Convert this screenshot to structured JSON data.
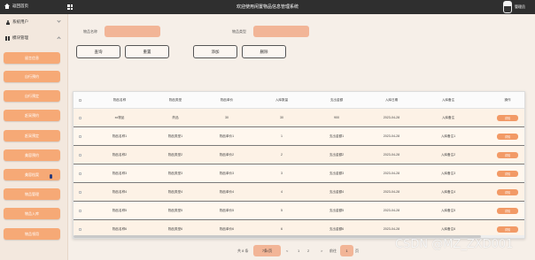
{
  "topbar": {
    "home_label": "返回首页",
    "title": "欢迎使用闲置物品信息管理系统",
    "username": "管理员"
  },
  "sidebar": {
    "groups": [
      {
        "label": "系统用户",
        "icon": "person-icon",
        "expanded": false
      },
      {
        "label": "模块管理",
        "icon": "apps-icon",
        "expanded": true
      }
    ],
    "items": [
      {
        "label": "留言信息"
      },
      {
        "label": "自行预约"
      },
      {
        "label": "自行预定"
      },
      {
        "label": "赶采预约"
      },
      {
        "label": "赶采预定"
      },
      {
        "label": "美容预约"
      },
      {
        "label": "美容档案"
      },
      {
        "label": "物品管理"
      },
      {
        "label": "物品入库"
      },
      {
        "label": "物品领用"
      }
    ],
    "active_item": "美容档案"
  },
  "search": {
    "name_label": "物品名称",
    "type_label": "物品类型",
    "name_value": "",
    "type_value": ""
  },
  "buttons": {
    "query": "查询",
    "reset": "重置",
    "add": "添加",
    "delete": "删除"
  },
  "table": {
    "columns": [
      "",
      "物品名称",
      "物品类型",
      "物品单价",
      "入库数量",
      "支出金额",
      "入库日期",
      "入库备注",
      "",
      "操作"
    ],
    "rows": [
      {
        "name": "xx物品",
        "type": "药品",
        "price": "30",
        "qty": "30",
        "amount": "900",
        "date": "2023-04-28",
        "note": "入库备注",
        "action": "详情"
      },
      {
        "name": "物品名称1",
        "type": "物品类型1",
        "price": "物品单价1",
        "qty": "1",
        "amount": "支出金额1",
        "date": "2023-04-28",
        "note": "入库备注1",
        "action": "详情"
      },
      {
        "name": "物品名称2",
        "type": "物品类型2",
        "price": "物品单价2",
        "qty": "2",
        "amount": "支出金额2",
        "date": "2023-04-28",
        "note": "入库备注2",
        "action": "详情"
      },
      {
        "name": "物品名称3",
        "type": "物品类型3",
        "price": "物品单价3",
        "qty": "3",
        "amount": "支出金额3",
        "date": "2023-04-28",
        "note": "入库备注3",
        "action": "详情"
      },
      {
        "name": "物品名称4",
        "type": "物品类型4",
        "price": "物品单价4",
        "qty": "4",
        "amount": "支出金额4",
        "date": "2023-04-28",
        "note": "入库备注4",
        "action": "详情"
      },
      {
        "name": "物品名称5",
        "type": "物品类型5",
        "price": "物品单价5",
        "qty": "5",
        "amount": "支出金额5",
        "date": "2023-04-28",
        "note": "入库备注5",
        "action": "详情"
      },
      {
        "name": "物品名称6",
        "type": "物品类型6",
        "price": "物品单价6",
        "qty": "6",
        "amount": "支出金额6",
        "date": "2023-04-28",
        "note": "入库备注6",
        "action": "详情"
      }
    ]
  },
  "pagination": {
    "total": "共 8 条",
    "page_size": "7条/页",
    "prev": "<",
    "pages": [
      "1",
      "2"
    ],
    "current": "1",
    "next": ">",
    "goto": "前往",
    "goto_value": "1",
    "page_unit": "页"
  },
  "watermark": "CSDN @MZ_ZXD001",
  "colors": {
    "accent": "#f6a976",
    "field": "#f2b597",
    "topbar": "#2f2f2f",
    "background": "#f6efe8"
  }
}
